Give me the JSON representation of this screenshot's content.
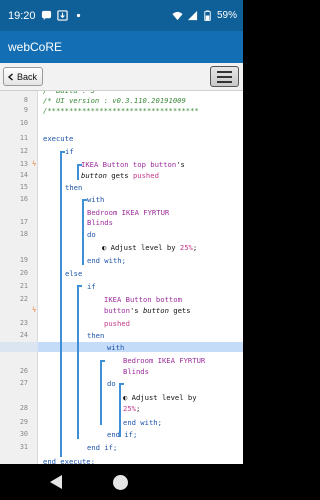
{
  "status": {
    "time": "19:20",
    "battery": "59%",
    "icons": [
      "chat-bubble-icon",
      "download-icon",
      "dot-icon",
      "wifi-icon",
      "signal-icon",
      "battery-icon"
    ]
  },
  "app": {
    "title": "webCoRE"
  },
  "toolbar": {
    "back_label": "Back"
  },
  "code": {
    "lines": [
      {
        "no": "",
        "parts": [
          {
            "c": "cm",
            "t": "/* Build        : 5"
          }
        ]
      },
      {
        "no": "8",
        "parts": [
          {
            "c": "cm",
            "t": "/* UI version : v0.3.110.20191009"
          }
        ]
      },
      {
        "no": "9",
        "parts": [
          {
            "c": "cm",
            "t": "/***********************************"
          }
        ]
      },
      {
        "no": "10",
        "parts": []
      },
      {
        "no": "11",
        "parts": [
          {
            "c": "kw",
            "t": "execute"
          }
        ]
      },
      {
        "no": "12",
        "parts": [
          {
            "c": "kw",
            "t": "if"
          }
        ]
      },
      {
        "no": "13",
        "parts": [
          {
            "c": "dev",
            "t": "IKEA Button top button"
          },
          {
            "c": "txt",
            "t": "'s"
          }
        ]
      },
      {
        "no": "14",
        "parts": [
          {
            "c": "attr",
            "t": "button"
          },
          {
            "c": "txt",
            "t": " gets "
          },
          {
            "c": "val",
            "t": "pushed"
          }
        ]
      },
      {
        "no": "15",
        "parts": [
          {
            "c": "kw",
            "t": "then"
          }
        ]
      },
      {
        "no": "16",
        "parts": [
          {
            "c": "kw",
            "t": "with"
          }
        ]
      },
      {
        "no": "",
        "parts": [
          {
            "c": "dev",
            "t": "Bedroom IKEA FYRTUR"
          }
        ]
      },
      {
        "no": "17",
        "parts": [
          {
            "c": "dev",
            "t": "Blinds"
          }
        ]
      },
      {
        "no": "18",
        "parts": [
          {
            "c": "kw",
            "t": "do"
          }
        ]
      },
      {
        "no": "",
        "parts": [
          {
            "c": "txt",
            "t": "Adjust level by "
          },
          {
            "c": "pct",
            "t": "25%"
          },
          {
            "c": "txt",
            "t": ";"
          }
        ]
      },
      {
        "no": "19",
        "parts": [
          {
            "c": "kw",
            "t": "end with;"
          }
        ]
      },
      {
        "no": "20",
        "parts": [
          {
            "c": "kw",
            "t": "else"
          }
        ]
      },
      {
        "no": "21",
        "parts": [
          {
            "c": "kw",
            "t": "if"
          }
        ]
      },
      {
        "no": "22",
        "parts": [
          {
            "c": "dev",
            "t": "IKEA Button bottom"
          }
        ]
      },
      {
        "no": "",
        "parts": [
          {
            "c": "dev",
            "t": "button"
          },
          {
            "c": "txt",
            "t": "'s "
          },
          {
            "c": "attr",
            "t": "button"
          },
          {
            "c": "txt",
            "t": " gets"
          }
        ]
      },
      {
        "no": "23",
        "parts": [
          {
            "c": "val",
            "t": "pushed"
          }
        ]
      },
      {
        "no": "24",
        "parts": [
          {
            "c": "kw",
            "t": "then"
          }
        ]
      },
      {
        "no": "25",
        "parts": [
          {
            "c": "kw",
            "t": "with"
          }
        ]
      },
      {
        "no": "",
        "parts": [
          {
            "c": "dev",
            "t": "Bedroom IKEA FYRTUR"
          }
        ]
      },
      {
        "no": "26",
        "parts": [
          {
            "c": "dev",
            "t": "Blinds"
          }
        ]
      },
      {
        "no": "27",
        "parts": [
          {
            "c": "kw",
            "t": "do"
          }
        ]
      },
      {
        "no": "",
        "parts": [
          {
            "c": "txt",
            "t": "Adjust level by"
          }
        ]
      },
      {
        "no": "28",
        "parts": [
          {
            "c": "pct",
            "t": "25%"
          },
          {
            "c": "txt",
            "t": ";"
          }
        ]
      },
      {
        "no": "29",
        "parts": [
          {
            "c": "kw",
            "t": "end with;"
          }
        ]
      },
      {
        "no": "30",
        "parts": [
          {
            "c": "kw",
            "t": "end if;"
          }
        ]
      },
      {
        "no": "31",
        "parts": [
          {
            "c": "kw",
            "t": "end if;"
          }
        ]
      },
      {
        "no": "",
        "parts": [
          {
            "c": "kw",
            "t": "end execute;"
          }
        ]
      }
    ]
  }
}
